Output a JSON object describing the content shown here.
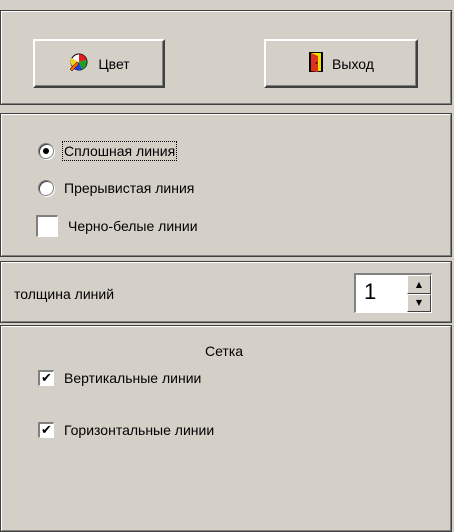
{
  "toolbar": {
    "color_label": "Цвет",
    "exit_label": "Выход"
  },
  "line_style": {
    "solid_label": "Сплошная линия",
    "dashed_label": "Прерывистая линия",
    "bw_label": "Черно-белые линии",
    "selected": "solid",
    "bw_checked": false
  },
  "thickness": {
    "label": "толщина линий",
    "value": "1"
  },
  "grid": {
    "title": "Сетка",
    "vertical_label": "Вертикальные линии",
    "horizontal_label": "Горизонтальные линии",
    "vertical_checked": true,
    "horizontal_checked": true
  },
  "colors": {
    "face": "#d4d0c8"
  }
}
